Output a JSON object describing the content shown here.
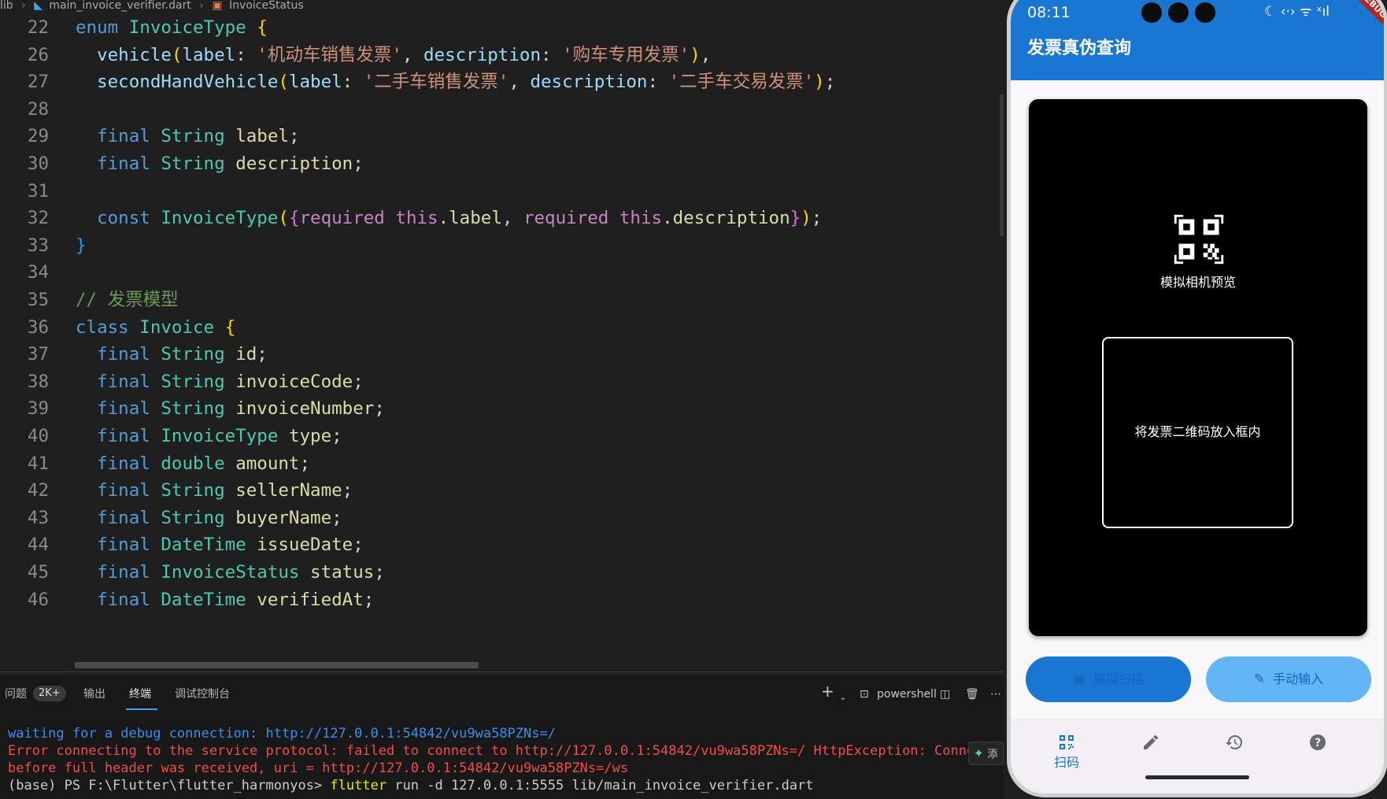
{
  "breadcrumb": {
    "root": "lib",
    "file": "main_invoice_verifier.dart",
    "symbol": "InvoiceStatus"
  },
  "editor": {
    "lines": [
      {
        "n": "22",
        "text": "enum InvoiceType {"
      },
      {
        "n": "26",
        "text": "vehicle(label: '机动车销售发票', description: '购车专用发票'),"
      },
      {
        "n": "27",
        "text": "secondHandVehicle(label: '二手车销售发票', description: '二手车交易发票');"
      },
      {
        "n": "28",
        "text": ""
      },
      {
        "n": "29",
        "text": "final String label;"
      },
      {
        "n": "30",
        "text": "final String description;"
      },
      {
        "n": "31",
        "text": ""
      },
      {
        "n": "32",
        "text": "const InvoiceType({required this.label, required this.description});"
      },
      {
        "n": "33",
        "text": "}"
      },
      {
        "n": "34",
        "text": ""
      },
      {
        "n": "35",
        "text": "// 发票模型"
      },
      {
        "n": "36",
        "text": "class Invoice {"
      },
      {
        "n": "37",
        "text": "final String id;"
      },
      {
        "n": "38",
        "text": "final String invoiceCode;"
      },
      {
        "n": "39",
        "text": "final String invoiceNumber;"
      },
      {
        "n": "40",
        "text": "final InvoiceType type;"
      },
      {
        "n": "41",
        "text": "final double amount;"
      },
      {
        "n": "42",
        "text": "final String sellerName;"
      },
      {
        "n": "43",
        "text": "final String buyerName;"
      },
      {
        "n": "44",
        "text": "final DateTime issueDate;"
      },
      {
        "n": "45",
        "text": "final InvoiceStatus status;"
      },
      {
        "n": "46",
        "text": "final DateTime verifiedAt;"
      }
    ]
  },
  "panel": {
    "tabs": [
      "问题",
      "输出",
      "终端",
      "调试控制台"
    ],
    "active_tab": "终端",
    "problems_badge": "2K+",
    "shell_name": "powershell",
    "add_label": "+",
    "chat_label": "添",
    "terminal": [
      {
        "kind": "blue",
        "text": "waiting for a debug connection: http://127.0.0.1:54842/vu9wa58PZNs=/"
      },
      {
        "kind": "red",
        "text": "Error connecting to the service protocol: failed to connect to http://127.0.0.1:54842/vu9wa58PZNs=/ HttpException: Connect"
      },
      {
        "kind": "red",
        "text": "before full header was received, uri = http://127.0.0.1:54842/vu9wa58PZNs=/ws"
      },
      {
        "kind": "prompt",
        "prefix": "(base) PS F:\\Flutter\\flutter_harmonyos> ",
        "cmd": "flutter",
        "args": " run -d 127.0.0.1:5555 lib/main_invoice_verifier.dart"
      }
    ]
  },
  "phone": {
    "status_time": "08:11",
    "status_icons": "☾ ‹·› ᯤ ˣıl",
    "debug_ribbon": "DEBUG",
    "app_title": "发票真伪查询",
    "camera_label": "模拟相机预览",
    "scan_hint": "将发票二维码放入框内",
    "btn_simulate": "模拟扫描",
    "btn_manual": "手动输入",
    "nav": [
      {
        "icon": "qr-scan-icon",
        "label": "扫码",
        "active": true
      },
      {
        "icon": "edit-icon",
        "label": "",
        "active": false
      },
      {
        "icon": "history-icon",
        "label": "",
        "active": false
      },
      {
        "icon": "help-icon",
        "label": "",
        "active": false
      }
    ],
    "colors": {
      "primary": "#1976d2",
      "light_primary": "#64b5f6",
      "nav_bg": "#f3eef6"
    }
  }
}
